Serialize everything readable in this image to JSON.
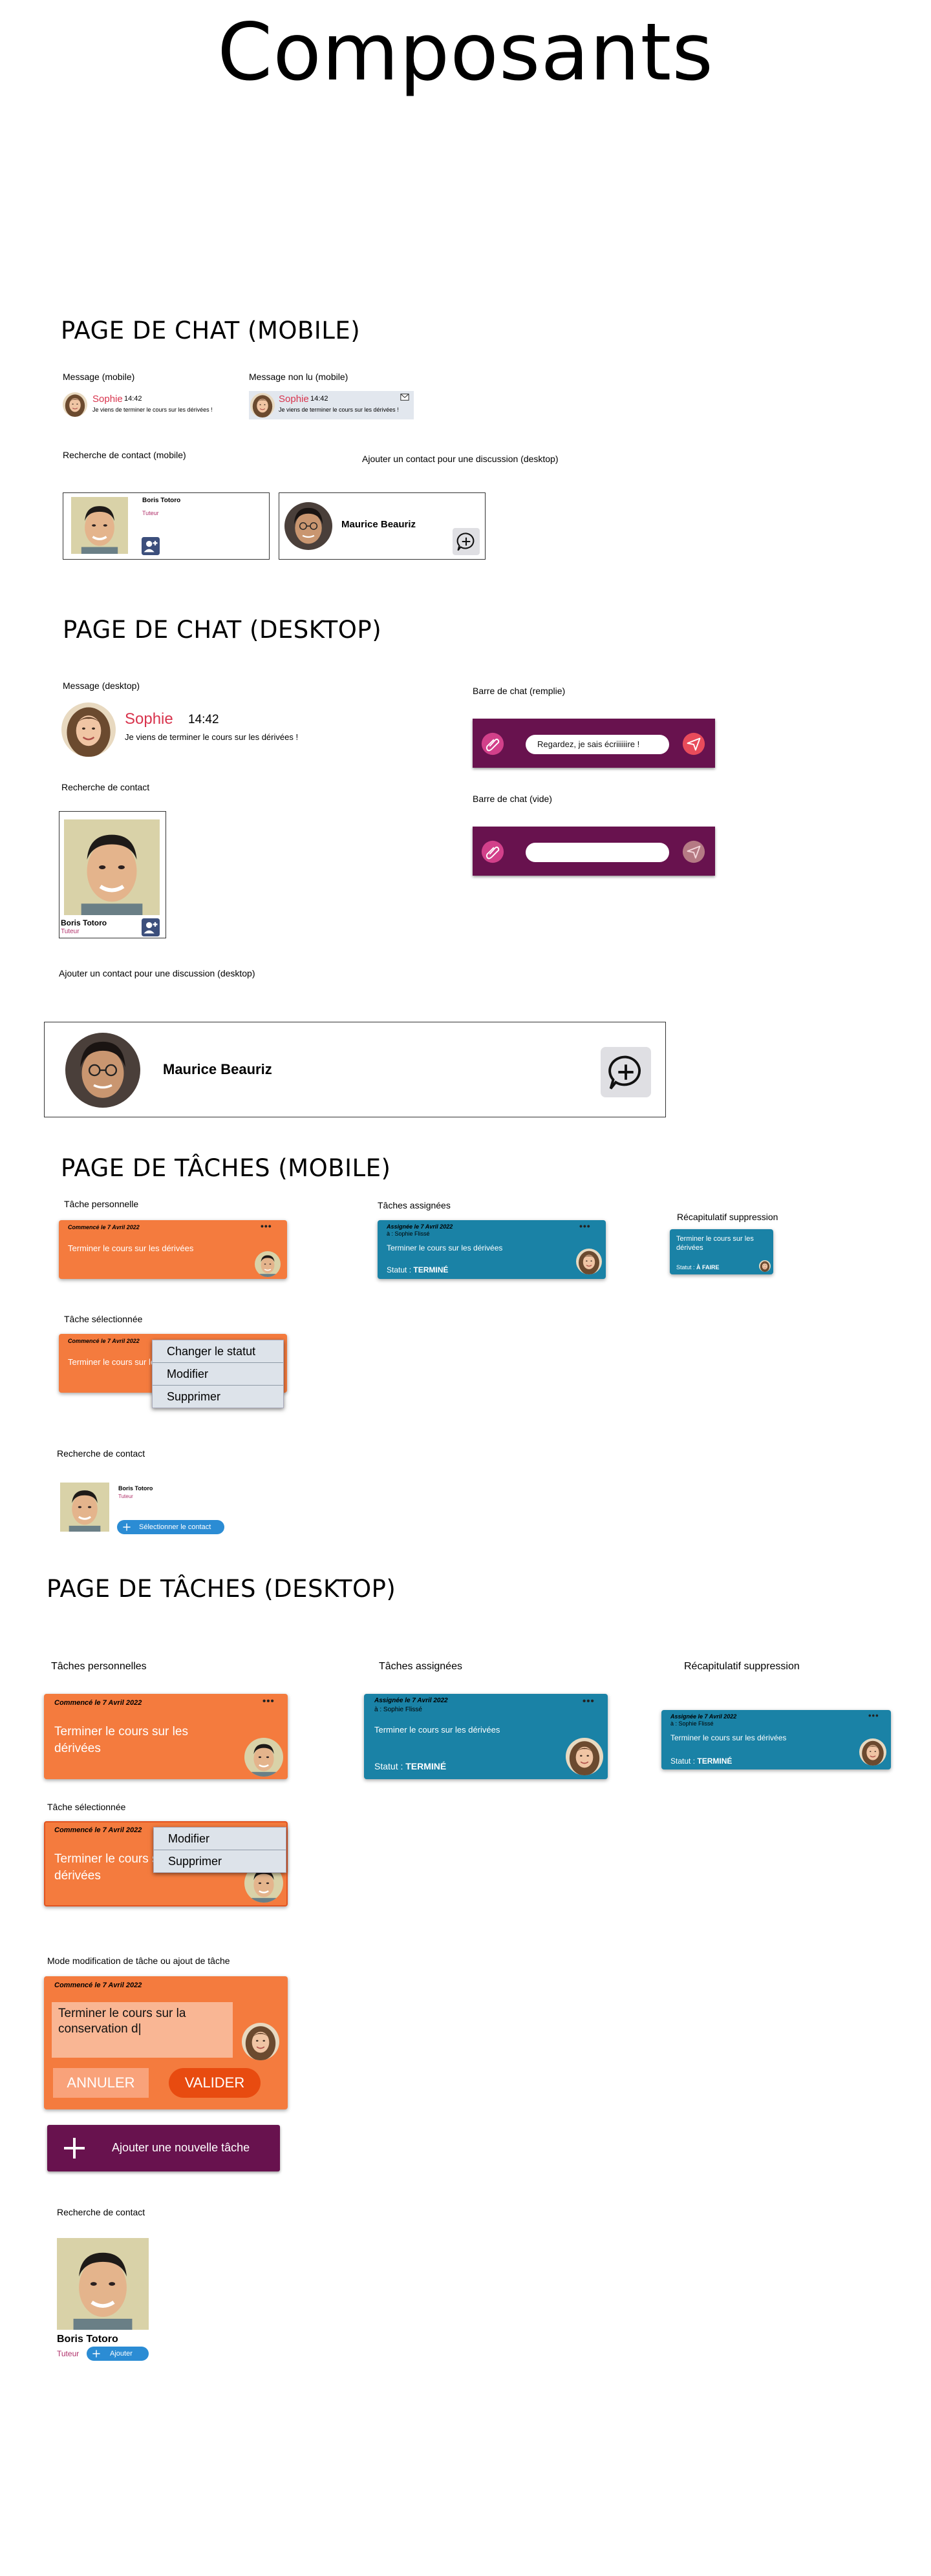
{
  "title": "Composants",
  "sections": {
    "chat_mobile": "PAGE DE CHAT (MOBILE)",
    "chat_desktop": "PAGE DE CHAT (DESKTOP)",
    "tasks_mobile": "PAGE DE TÂCHES (MOBILE)",
    "tasks_desktop": "PAGE DE TÂCHES (DESKTOP)"
  },
  "chat_mobile": {
    "label_message": "Message (mobile)",
    "label_unread": "Message non lu (mobile)",
    "label_contact_search": "Recherche de contact (mobile)",
    "label_add_contact": "Ajouter un contact pour une discussion (desktop)",
    "message": {
      "name": "Sophie",
      "time": "14:42",
      "text": "Je viens de terminer le cours sur les dérivées !"
    },
    "unread": {
      "name": "Sophie",
      "time": "14:42",
      "text": "Je viens de terminer le cours sur les dérivées !"
    },
    "contact": {
      "name": "Boris Totoro",
      "role": "Tuteur"
    },
    "add_contact": {
      "name": "Maurice Beauriz"
    }
  },
  "chat_desktop": {
    "label_message": "Message (desktop)",
    "label_contact_search": "Recherche de contact",
    "label_add_contact": "Ajouter un contact pour une discussion (desktop)",
    "label_bar_filled": "Barre de chat (remplie)",
    "label_bar_empty": "Barre de chat (vide)",
    "message": {
      "name": "Sophie",
      "time": "14:42",
      "text": "Je viens de terminer le cours sur les dérivées !"
    },
    "contact": {
      "name": "Boris Totoro",
      "role": "Tuteur"
    },
    "add_contact": {
      "name": "Maurice Beauriz"
    },
    "bar_filled_text": "Regardez, je sais écriiiiiire !",
    "bar_empty_text": ""
  },
  "tasks_mobile": {
    "label_personal": "Tâche personnelle",
    "label_assigned": "Tâches assignées",
    "label_summary": "Récapitulatif suppression",
    "label_selected": "Tâche sélectionnée",
    "label_contact_search": "Recherche de contact",
    "personal": {
      "date": "Commencé le 7 Avril 2022",
      "text": "Terminer le cours sur les dérivées"
    },
    "assigned": {
      "date": "Assignée le 7 Avril 2022",
      "by": "à : Sophie Flissé",
      "text": "Terminer le cours sur les dérivées",
      "status_label": "Statut : ",
      "status": "TERMINÉ"
    },
    "summary": {
      "text": "Terminer le cours sur les dérivées",
      "status_label": "Statut : ",
      "status": "À FAIRE"
    },
    "selected": {
      "date": "Commencé le 7 Avril 2022",
      "text": "Terminer le cours sur les dérivées"
    },
    "menu": [
      "Changer le statut",
      "Modifier",
      "Supprimer"
    ],
    "contact": {
      "name": "Boris Totoro",
      "role": "Tuteur",
      "button": "Sélectionner le contact"
    }
  },
  "tasks_desktop": {
    "label_personal": "Tâches personnelles",
    "label_assigned": "Tâches assignées",
    "label_summary": "Récapitulatif suppression",
    "label_selected": "Tâche sélectionnée",
    "label_edit": "Mode modification de tâche ou ajout de tâche",
    "label_contact_search": "Recherche de contact",
    "personal": {
      "date": "Commencé le 7 Avril 2022",
      "text": "Terminer le cours sur les dérivées"
    },
    "assigned": {
      "date": "Assignée le 7 Avril 2022",
      "by": "à : Sophie Flissé",
      "text": "Terminer le cours sur les dérivées",
      "status_label": "Statut : ",
      "status": "TERMINÉ"
    },
    "summary": {
      "date": "Assignée le 7 Avril 2022",
      "by": "à : Sophie Flissé",
      "text": "Terminer le cours sur les dérivées",
      "status_label": "Statut : ",
      "status": "TERMINÉ"
    },
    "selected": {
      "date": "Commencé le 7 Avril 2022",
      "text": "Terminer le cours sur les dérivées"
    },
    "menu": [
      "Modifier",
      "Supprimer"
    ],
    "edit": {
      "date": "Commencé le 7 Avril 2022",
      "value": "Terminer le cours sur la conservation d|",
      "cancel": "ANNULER",
      "validate": "VALIDER"
    },
    "add_task": "Ajouter une nouvelle tâche",
    "contact": {
      "name": "Boris Totoro",
      "role": "Tuteur",
      "button": "Ajouter"
    }
  },
  "icons": [
    "paperclip-icon",
    "send-icon",
    "add-chat-icon",
    "add-contact-icon",
    "plus-icon",
    "more-icon",
    "mail-icon"
  ],
  "colors": {
    "orange": "#f47b3e",
    "blue": "#1a82a6",
    "plum": "#68124e",
    "red_name": "#d8344d",
    "send": "#e84b5b",
    "navy_icon": "#3c4f7c"
  }
}
